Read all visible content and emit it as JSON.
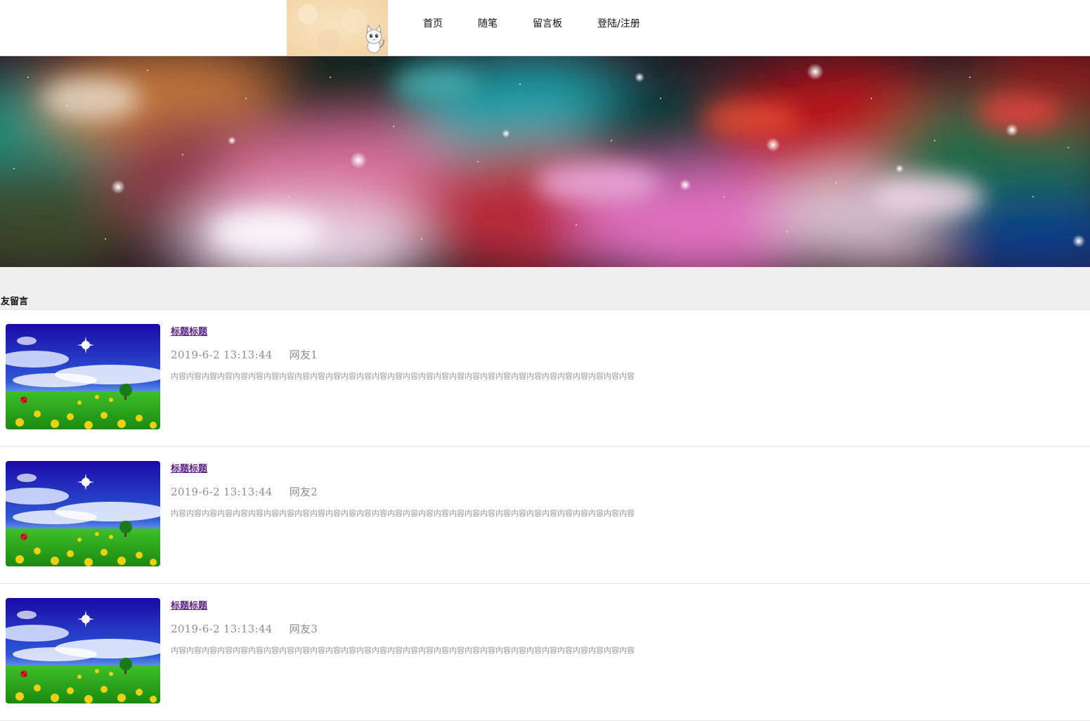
{
  "header": {
    "logo_icon": "cat-avatar-logo",
    "nav": [
      {
        "label": "首页"
      },
      {
        "label": "随笔"
      },
      {
        "label": "留言板"
      },
      {
        "label": "登陆/注册"
      }
    ]
  },
  "banner": {
    "icon": "galaxy-nebula-banner"
  },
  "section": {
    "title": "友留言"
  },
  "messages": [
    {
      "title": "标题标题",
      "date": "2019-6-2 13:13:44",
      "author": "网友1",
      "content": "内容内容内容内容内容内容内容内容内容内容内容内容内容内容内容内容内容内容内容内容内容内容内容内容内容内容内容内容内容内容",
      "thumbnail": "meadow-sky-flowers-image"
    },
    {
      "title": "标题标题",
      "date": "2019-6-2 13:13:44",
      "author": "网友2",
      "content": "内容内容内容内容内容内容内容内容内容内容内容内容内容内容内容内容内容内容内容内容内容内容内容内容内容内容内容内容内容内容",
      "thumbnail": "meadow-sky-flowers-image"
    },
    {
      "title": "标题标题",
      "date": "2019-6-2 13:13:44",
      "author": "网友3",
      "content": "内容内容内容内容内容内容内容内容内容内容内容内容内容内容内容内容内容内容内容内容内容内容内容内容内容内容内容内容内容内容",
      "thumbnail": "meadow-sky-flowers-image"
    }
  ],
  "colors": {
    "title_link": "#5a1d87",
    "meta_text": "#8e8e8e",
    "section_band": "#efefef"
  }
}
